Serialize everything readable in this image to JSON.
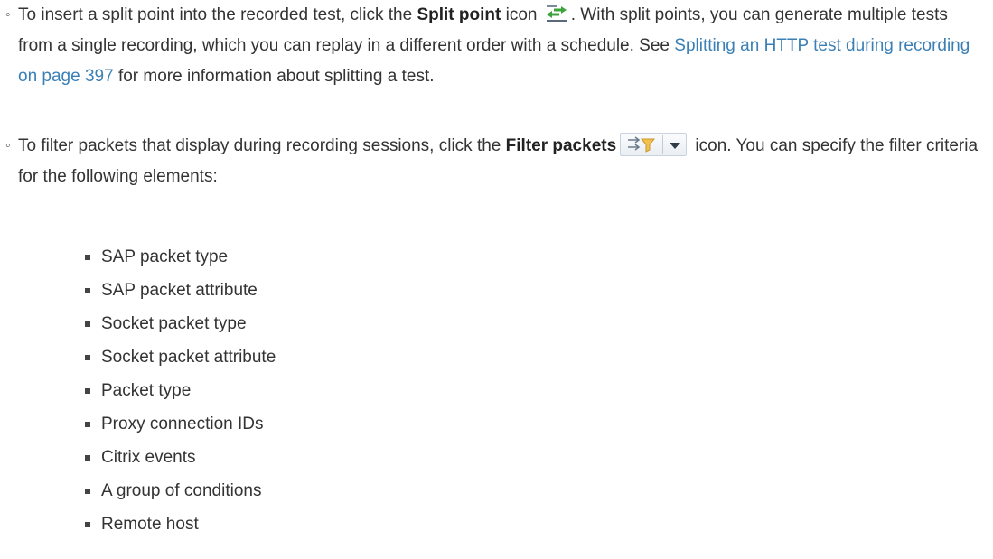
{
  "item1": {
    "intro": "To insert a split point into the recorded test, click the ",
    "bold": "Split point",
    "after_bold": " icon ",
    "after_icon": ". With split points, you can generate multiple tests from a single recording, which you can replay in a different order with a schedule. See ",
    "link": "Splitting an HTTP test during recording on page 397",
    "end": " for more information about splitting a test."
  },
  "item2": {
    "intro": "To filter packets that display during recording sessions, click the ",
    "bold": "Filter packets",
    "end": " icon. You can specify the filter criteria for the following elements:"
  },
  "filter_elements": [
    "SAP packet type",
    "SAP packet attribute",
    "Socket packet type",
    "Socket packet attribute",
    "Packet type",
    "Proxy connection IDs",
    "Citrix events",
    "A group of conditions",
    "Remote host"
  ],
  "icons": {
    "split_point": "split-point-icon",
    "filter_packets": "filter-packets-icon",
    "dropdown": "chevron-down-icon"
  },
  "colors": {
    "text": "#333333",
    "link": "#3a7fb5"
  }
}
